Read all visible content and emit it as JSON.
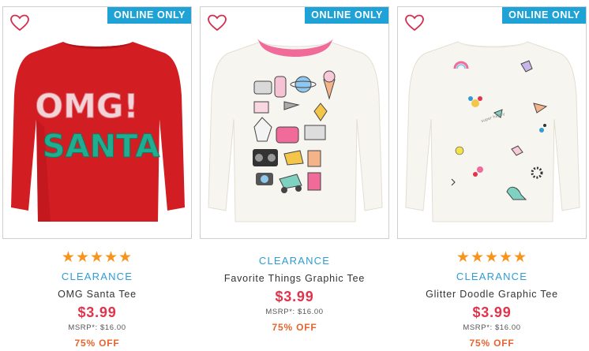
{
  "colors": {
    "badge": "#1fa2d6",
    "stars": "#f7941d",
    "clearance": "#2f9cd3",
    "price": "#e2334a",
    "discount": "#e7632d"
  },
  "products": [
    {
      "badge": "ONLINE ONLY",
      "stars": "★★★★★",
      "rating": 5,
      "tag": "CLEARANCE",
      "name": "OMG Santa Tee",
      "price": "$3.99",
      "msrp": "MSRP*: $16.00",
      "discount": "75% OFF",
      "shirt_color": "#d21d23",
      "graphic_text": [
        "OMG!",
        "SANTA"
      ]
    },
    {
      "badge": "ONLINE ONLY",
      "tag": "CLEARANCE",
      "name": "Favorite Things Graphic Tee",
      "price": "$3.99",
      "msrp": "MSRP*: $16.00",
      "discount": "75% OFF",
      "shirt_color": "#f7f5ef",
      "collar_color": "#f06a9a"
    },
    {
      "badge": "ONLINE ONLY",
      "stars": "★★★★★",
      "rating": 5,
      "tag": "CLEARANCE",
      "name": "Glitter Doodle Graphic Tee",
      "price": "$3.99",
      "msrp": "MSRP*: $16.00",
      "discount": "75% OFF",
      "shirt_color": "#f7f5ef"
    }
  ]
}
